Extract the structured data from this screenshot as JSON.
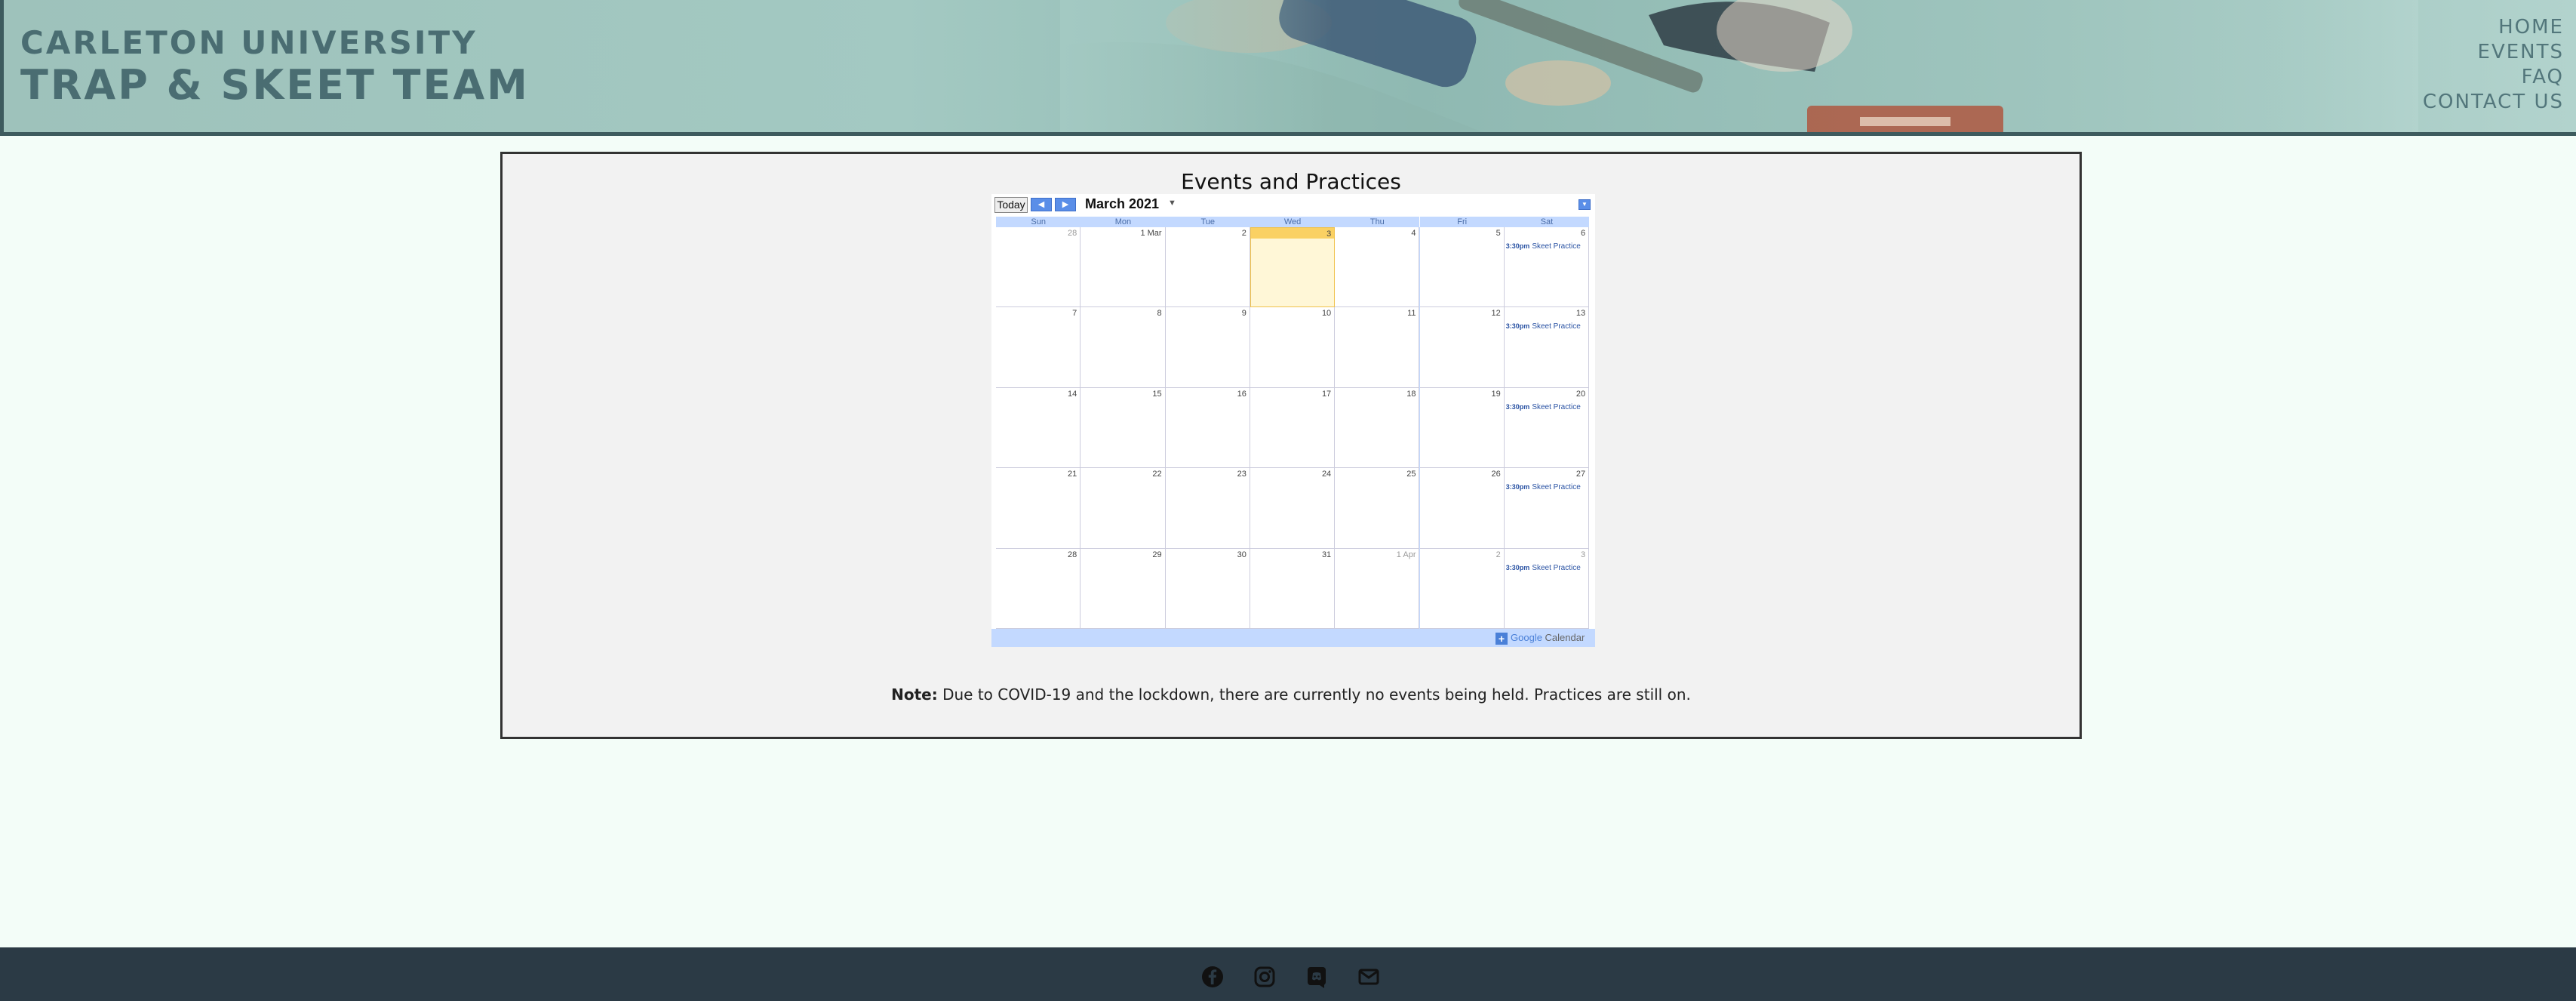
{
  "brand": {
    "line1": "CARLETON UNIVERSITY",
    "line2": "TRAP & SKEET TEAM"
  },
  "nav": {
    "home": "HOME",
    "events": "EVENTS",
    "faq": "FAQ",
    "contact": "CONTACT US"
  },
  "panel": {
    "title": "Events and Practices",
    "note_label": "Note:",
    "note_text": " Due to COVID-19 and the lockdown, there are currently no events being held. Practices are still on."
  },
  "calendar": {
    "today_label": "Today",
    "prev_icon": "◀",
    "next_icon": "▶",
    "month_label": "March 2021",
    "weekdays": [
      "Sun",
      "Mon",
      "Tue",
      "Wed",
      "Thu",
      "Fri",
      "Sat"
    ],
    "weeks": [
      [
        "28",
        "1 Mar",
        "2",
        "3",
        "4",
        "5",
        "6"
      ],
      [
        "7",
        "8",
        "9",
        "10",
        "11",
        "12",
        "13"
      ],
      [
        "14",
        "15",
        "16",
        "17",
        "18",
        "19",
        "20"
      ],
      [
        "21",
        "22",
        "23",
        "24",
        "25",
        "26",
        "27"
      ],
      [
        "28",
        "29",
        "30",
        "31",
        "1 Apr",
        "2",
        "3"
      ]
    ],
    "muted_days": [
      [
        0,
        0
      ],
      [
        4,
        4
      ],
      [
        4,
        5
      ],
      [
        4,
        6
      ]
    ],
    "today_cell": [
      0,
      3
    ],
    "event_time": "3:30pm",
    "event_title": "Skeet Practice",
    "footer_plus": "+",
    "footer_google": "Google",
    "footer_calendar": "Calendar"
  },
  "footer": {
    "icons": [
      "facebook-icon",
      "instagram-icon",
      "discord-icon",
      "mail-icon"
    ]
  },
  "colors": {
    "header_text": "#4a6d72",
    "footer_bg": "#2b3a45",
    "page_bg": "#f3fdf8"
  }
}
